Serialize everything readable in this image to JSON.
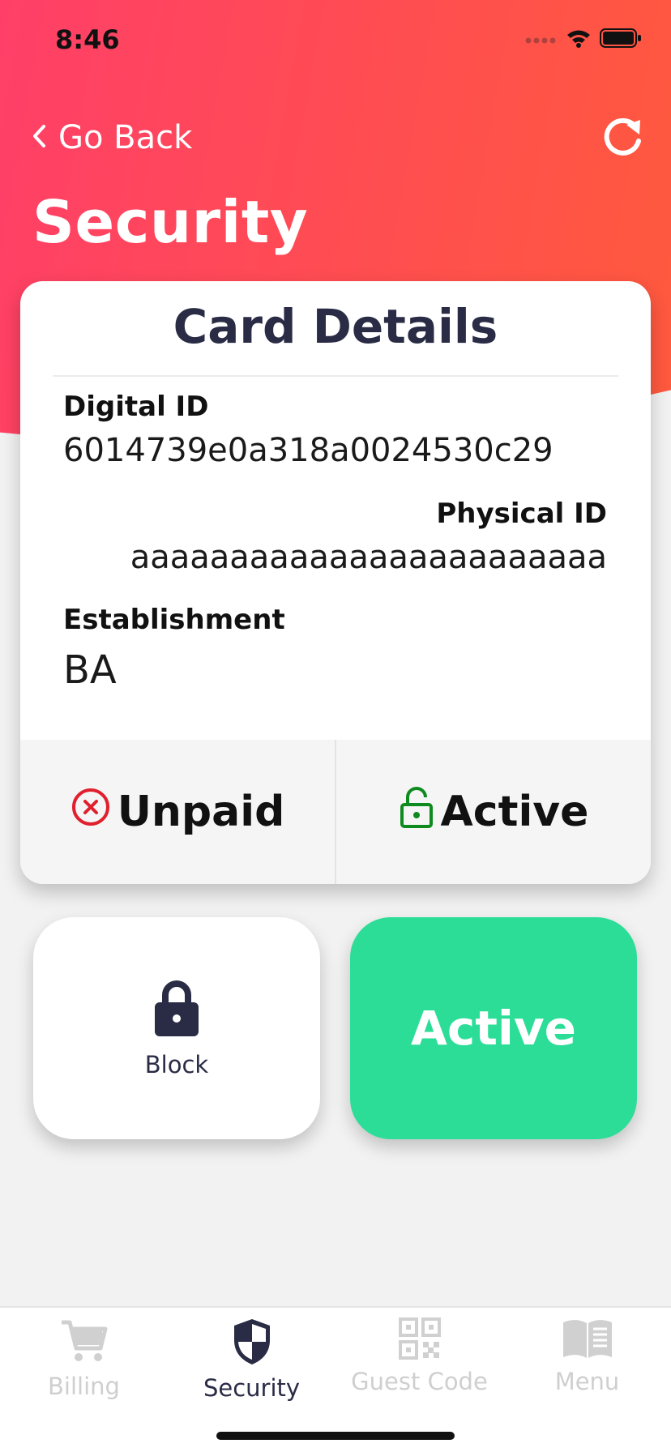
{
  "status_bar": {
    "time": "8:46",
    "icons": [
      "signal-icon",
      "wifi-icon",
      "battery-icon"
    ]
  },
  "nav": {
    "back_label": "Go Back",
    "refresh_icon": "refresh-icon"
  },
  "page": {
    "title": "Security"
  },
  "card": {
    "title": "Card Details",
    "digital_id_label": "Digital ID",
    "digital_id_value": "6014739e0a318a0024530c29",
    "physical_id_label": "Physical ID",
    "physical_id_value": "aaaaaaaaaaaaaaaaaaaaaaaa",
    "establishment_label": "Establishment",
    "establishment_value": "BA",
    "payment_status": {
      "label": "Unpaid",
      "icon": "x-circle-icon",
      "color": "#e0202d"
    },
    "card_status": {
      "label": "Active",
      "icon": "unlock-icon",
      "color": "#0f8a1f"
    }
  },
  "actions": {
    "block_label": "Block",
    "active_label": "Active",
    "active_color": "#2cdd98"
  },
  "tabbar": {
    "tabs": [
      {
        "label": "Billing",
        "icon": "cart-icon",
        "selected": false
      },
      {
        "label": "Security",
        "icon": "shield-icon",
        "selected": true
      },
      {
        "label": "Guest Code",
        "icon": "qr-code-icon",
        "selected": false
      },
      {
        "label": "Menu",
        "icon": "book-icon",
        "selected": false
      }
    ]
  },
  "colors": {
    "header_gradient_start": "#ff3f68",
    "header_gradient_end": "#ff5a3d",
    "dark_text": "#2a2c46",
    "background": "#f2f2f2"
  }
}
